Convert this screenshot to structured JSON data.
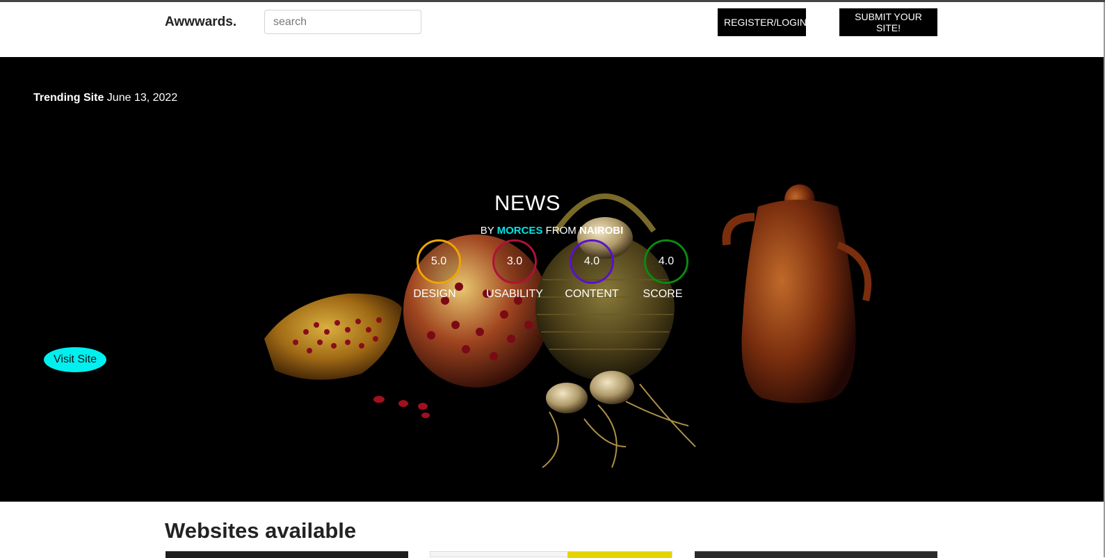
{
  "navbar": {
    "brand": "Awwwards.",
    "search_placeholder": "search",
    "register_label": "REGISTER/LOGIN",
    "submit_label": "SUBMIT YOUR SITE!"
  },
  "hero": {
    "trending_label": "Trending Site",
    "trending_date": "June 13, 2022",
    "site_title": "NEWS",
    "by_label": "BY",
    "author": "MORCES",
    "from_label": "FROM",
    "city": "NAIROBI",
    "ratings": [
      {
        "value": "5.0",
        "label": "DESIGN",
        "color": "#f0a500"
      },
      {
        "value": "3.0",
        "label": "USABILITY",
        "color": "#b0103a"
      },
      {
        "value": "4.0",
        "label": "CONTENT",
        "color": "#5a10d0"
      },
      {
        "value": "4.0",
        "label": "SCORE",
        "color": "#0a8a10"
      }
    ],
    "visit_label": "Visit Site"
  },
  "section": {
    "title": "Websites available"
  },
  "colors": {
    "accent": "#00e5e5",
    "visit_button": "#00f0f0",
    "hero_bg": "#000000"
  }
}
